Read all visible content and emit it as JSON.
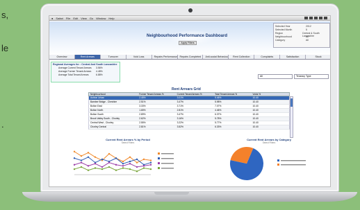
{
  "side_text": {
    "line1": "s,",
    "line2": "le",
    "line3": "."
  },
  "app": {
    "title": "Neighbourhood Performance Dashboard",
    "apply_button": "Apply Filters"
  },
  "menubar": [
    "Safari",
    "File",
    "Edit",
    "View",
    "Go",
    "Window",
    "Help"
  ],
  "info": [
    {
      "k": "Selected Year",
      "v": "2012"
    },
    {
      "k": "Selected Month",
      "v": "5"
    },
    {
      "k": "Region",
      "v": "Central & South Lancashire"
    },
    {
      "k": "Neighbourhood",
      "v": "All"
    },
    {
      "k": "Category",
      "v": "All"
    }
  ],
  "tabs": [
    "Overview",
    "Rent Arrears",
    "Turnover",
    "Void Loss",
    "Repairs Performance",
    "Repairs Completed",
    "Anti-social Behaviour",
    "Rent Collection",
    "Complaints",
    "Satisfaction",
    "Stock"
  ],
  "active_tab_index": 1,
  "averages": {
    "title": "Regional Averages for : Central And South Lancashire",
    "rows": [
      {
        "k": "Average Current Tenant Arrears",
        "v": "3.56%"
      },
      {
        "k": "Average Former Tenant Arrears",
        "v": "4.48%"
      },
      {
        "k": "Average Total Tenant Arrears",
        "v": "6.88%"
      }
    ]
  },
  "selectors": [
    "All",
    "Tenancy Type"
  ],
  "grid": {
    "title": "Rent Arrears Grid",
    "columns": [
      "Neighbourhood",
      "Former Tenant Arrears %",
      "Current Tenant Arrears %",
      "Total Tenant Arrears %",
      "Voids %"
    ],
    "rows": [
      [
        "Ashton Urban",
        "2.45%",
        "3.01%",
        "5.46%",
        "10.40"
      ],
      [
        "Bamber Bridge - Cheshire",
        "2.51%",
        "3.47%",
        "5.98%",
        "10.40"
      ],
      [
        "Bolton East",
        "3.33%",
        "3.71%",
        "7.07%",
        "10.40"
      ],
      [
        "Bolton North",
        "1.65%",
        "2.81%",
        "4.46%",
        "10.40"
      ],
      [
        "Bolton South",
        "2.89%",
        "3.47%",
        "6.37%",
        "10.40"
      ],
      [
        "Brook Valley South - Chorley",
        "2.62%",
        "3.16%",
        "5.78%",
        "10.40"
      ],
      [
        "Central West - Chorley",
        "2.55%",
        "3.22%",
        "5.77%",
        "10.40"
      ],
      [
        "Chorley Central",
        "2.81%",
        "3.52%",
        "6.33%",
        "10.40"
      ]
    ],
    "selected_row": 0
  },
  "left_chart": {
    "title": "Current Rent Arrears % by Period",
    "subtitle": "Select Filters"
  },
  "right_chart": {
    "title": "Current Rent Arrears by Category",
    "subtitle": "Select Filters"
  },
  "chart_data": [
    {
      "type": "line",
      "title": "Current Rent Arrears % by Period",
      "x": [
        1,
        2,
        3,
        4,
        5,
        6,
        7,
        8,
        9,
        10,
        11,
        12
      ],
      "series": [
        {
          "values": [
            4.0,
            3.6,
            3.9,
            3.5,
            3.2,
            3.8,
            3.4,
            3.1,
            3.5,
            3.0,
            3.3,
            3.2
          ]
        },
        {
          "values": [
            3.4,
            3.2,
            3.5,
            3.0,
            3.3,
            3.1,
            3.4,
            2.9,
            3.1,
            3.3,
            2.8,
            3.0
          ]
        },
        {
          "values": [
            2.8,
            3.0,
            2.7,
            2.9,
            2.6,
            3.0,
            2.8,
            2.7,
            2.9,
            2.6,
            2.7,
            2.8
          ]
        },
        {
          "values": [
            2.4,
            2.6,
            2.3,
            2.5,
            2.4,
            2.6,
            2.3,
            2.5,
            2.4,
            2.2,
            2.5,
            2.4
          ]
        }
      ],
      "colors": [
        "#f08a2c",
        "#2f5fb3",
        "#9b3fa8",
        "#7aa63c"
      ]
    },
    {
      "type": "pie",
      "title": "Current Rent Arrears by Category",
      "values": [
        72,
        28
      ],
      "colors": [
        "#2f66c1",
        "#f4812b"
      ]
    }
  ]
}
